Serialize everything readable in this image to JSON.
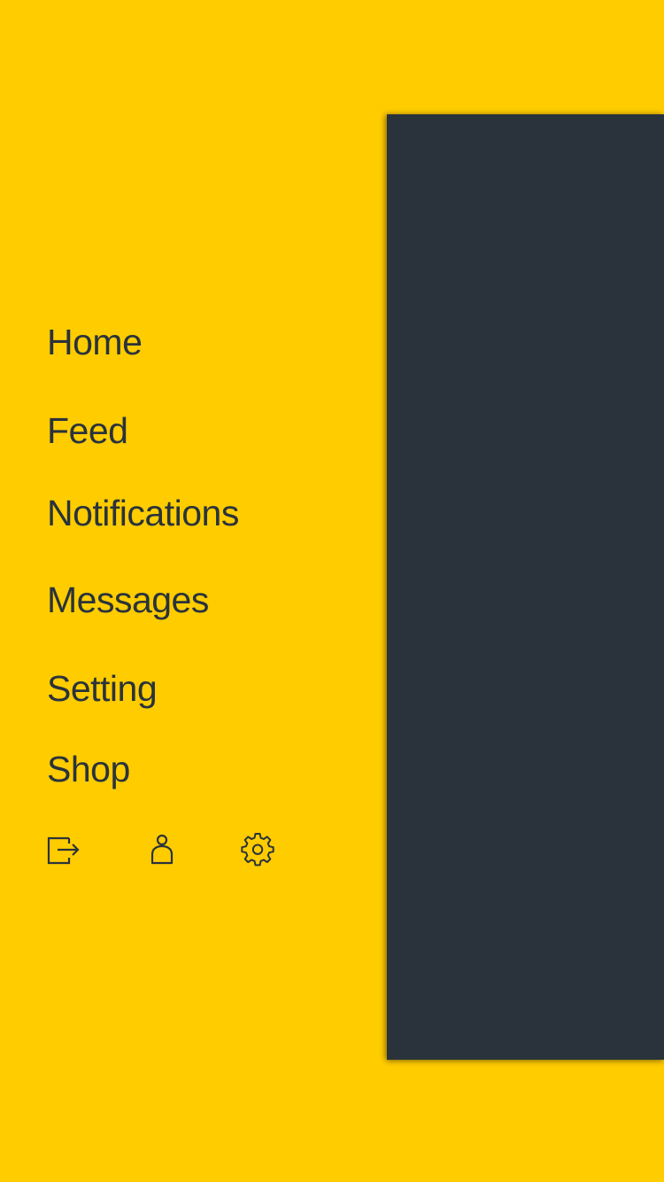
{
  "theme": {
    "background": "#FFCC00",
    "text": "#2A333B",
    "panel": "#2A333B"
  },
  "menu": {
    "items": [
      {
        "label": "Home"
      },
      {
        "label": "Feed"
      },
      {
        "label": "Notifications"
      },
      {
        "label": "Messages"
      },
      {
        "label": "Setting"
      },
      {
        "label": "Shop"
      }
    ]
  },
  "actions": {
    "icons": [
      "logout-icon",
      "user-icon",
      "gear-icon"
    ]
  }
}
